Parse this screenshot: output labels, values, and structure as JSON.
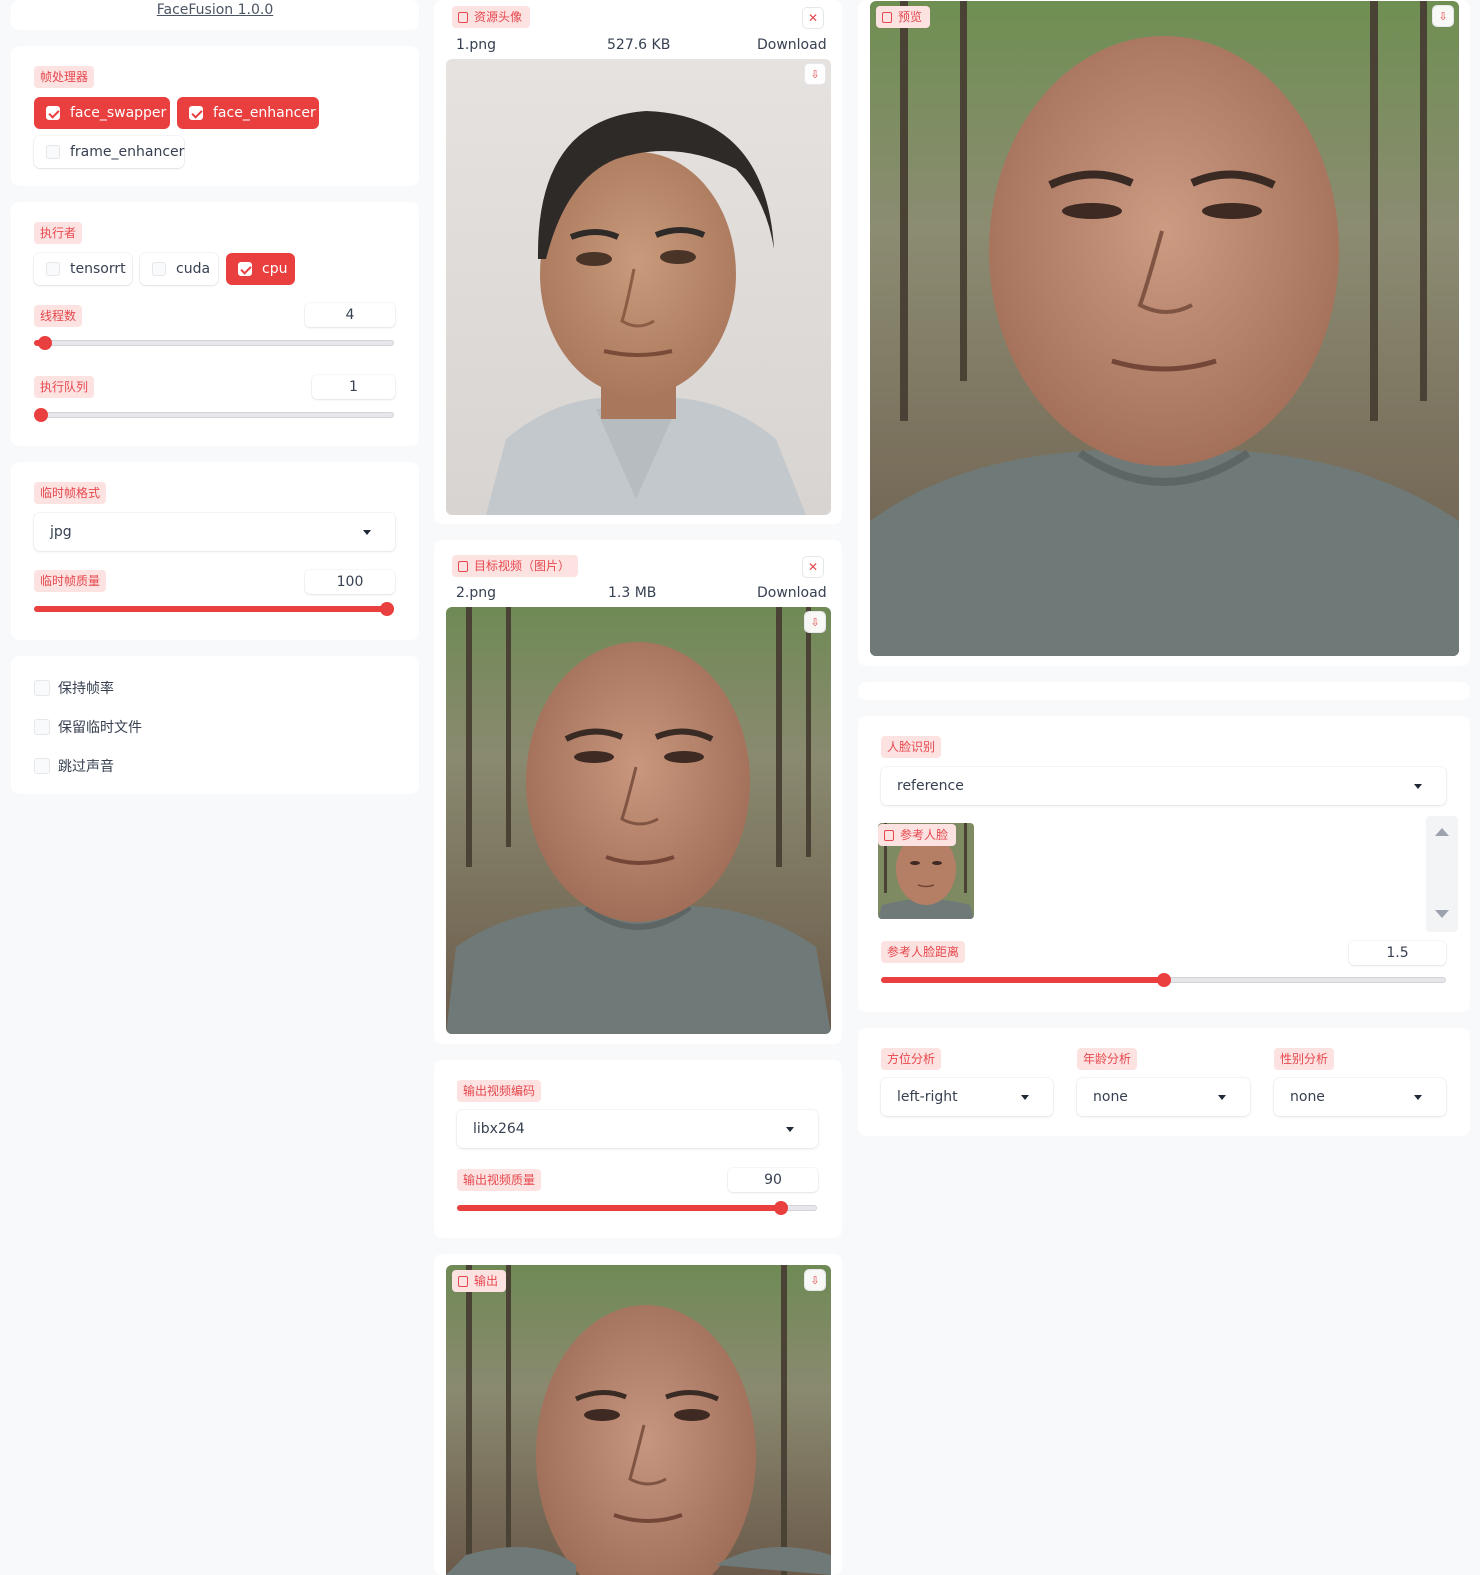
{
  "app_title": "FaceFusion 1.0.0",
  "frame_processors": {
    "label": "帧处理器",
    "options": [
      {
        "label": "face_swapper",
        "checked": true
      },
      {
        "label": "face_enhancer",
        "checked": true
      },
      {
        "label": "frame_enhancer",
        "checked": false
      }
    ]
  },
  "execution_providers": {
    "label": "执行者",
    "options": [
      {
        "label": "tensorrt",
        "checked": false
      },
      {
        "label": "cuda",
        "checked": false
      },
      {
        "label": "cpu",
        "checked": true
      }
    ],
    "thread_count": {
      "label": "线程数",
      "value": "4",
      "fraction": 0.03
    },
    "queue_count": {
      "label": "执行队列",
      "value": "1",
      "fraction": 0.0
    }
  },
  "temp_frame": {
    "format_label": "临时帧格式",
    "format_value": "jpg",
    "quality_label": "临时帧质量",
    "quality_value": "100",
    "quality_fraction": 1.0
  },
  "settings": [
    {
      "label": "保持帧率",
      "checked": false
    },
    {
      "label": "保留临时文件",
      "checked": false
    },
    {
      "label": "跳过声音",
      "checked": false
    }
  ],
  "source": {
    "label": "资源头像",
    "file_name": "1.png",
    "file_size": "527.6 KB",
    "download": "Download"
  },
  "target": {
    "label": "目标视频（图片）",
    "file_name": "2.png",
    "file_size": "1.3 MB",
    "download": "Download"
  },
  "output_video": {
    "encoder_label": "输出视频编码",
    "encoder_value": "libx264",
    "quality_label": "输出视频质量",
    "quality_value": "90",
    "quality_fraction": 0.9
  },
  "output": {
    "label": "输出"
  },
  "preview": {
    "label": "预览"
  },
  "face_recognition": {
    "label": "人脸识别",
    "value": "reference",
    "reference_label": "参考人脸",
    "distance_label": "参考人脸距离",
    "distance_value": "1.5",
    "distance_fraction": 0.5
  },
  "analysers": [
    {
      "label": "方位分析",
      "value": "left-right"
    },
    {
      "label": "年龄分析",
      "value": "none"
    },
    {
      "label": "性别分析",
      "value": "none"
    }
  ],
  "colors": {
    "accent": "#ea3f3f",
    "tag_bg": "#fde2e2",
    "tag_text": "#e5484d"
  }
}
